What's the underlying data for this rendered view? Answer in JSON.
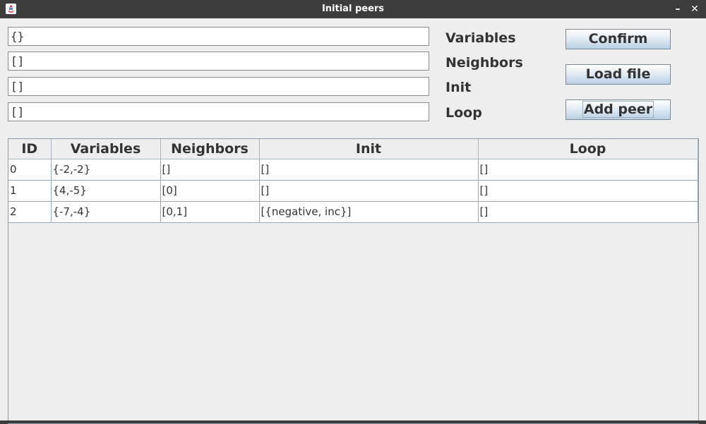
{
  "window": {
    "title": "Initial peers",
    "minimize_glyph": "–",
    "close_glyph": "✕",
    "icon": "java-app-icon"
  },
  "form": {
    "variables_value": "{}",
    "neighbors_value": "[]",
    "init_value": "[]",
    "loop_value": "[]",
    "variables_label": "Variables",
    "neighbors_label": "Neighbors",
    "init_label": "Init",
    "loop_label": "Loop"
  },
  "buttons": {
    "confirm": "Confirm",
    "load_file": "Load file",
    "add_peer": "Add peer"
  },
  "table": {
    "headers": [
      "ID",
      "Variables",
      "Neighbors",
      "Init",
      "Loop"
    ],
    "rows": [
      {
        "id": "0",
        "variables": "{-2,-2}",
        "neighbors": "[]",
        "init": "[]",
        "loop": "[]"
      },
      {
        "id": "1",
        "variables": "{4,-5}",
        "neighbors": "[0]",
        "init": "[]",
        "loop": "[]"
      },
      {
        "id": "2",
        "variables": "{-7,-4}",
        "neighbors": "[0,1]",
        "init": "[{negative, inc}]",
        "loop": "[]"
      }
    ]
  },
  "colors": {
    "titlebar": "#3c3c3c",
    "window_bg": "#eeeeee",
    "button_gradient_bottom": "#b8cfe5"
  }
}
